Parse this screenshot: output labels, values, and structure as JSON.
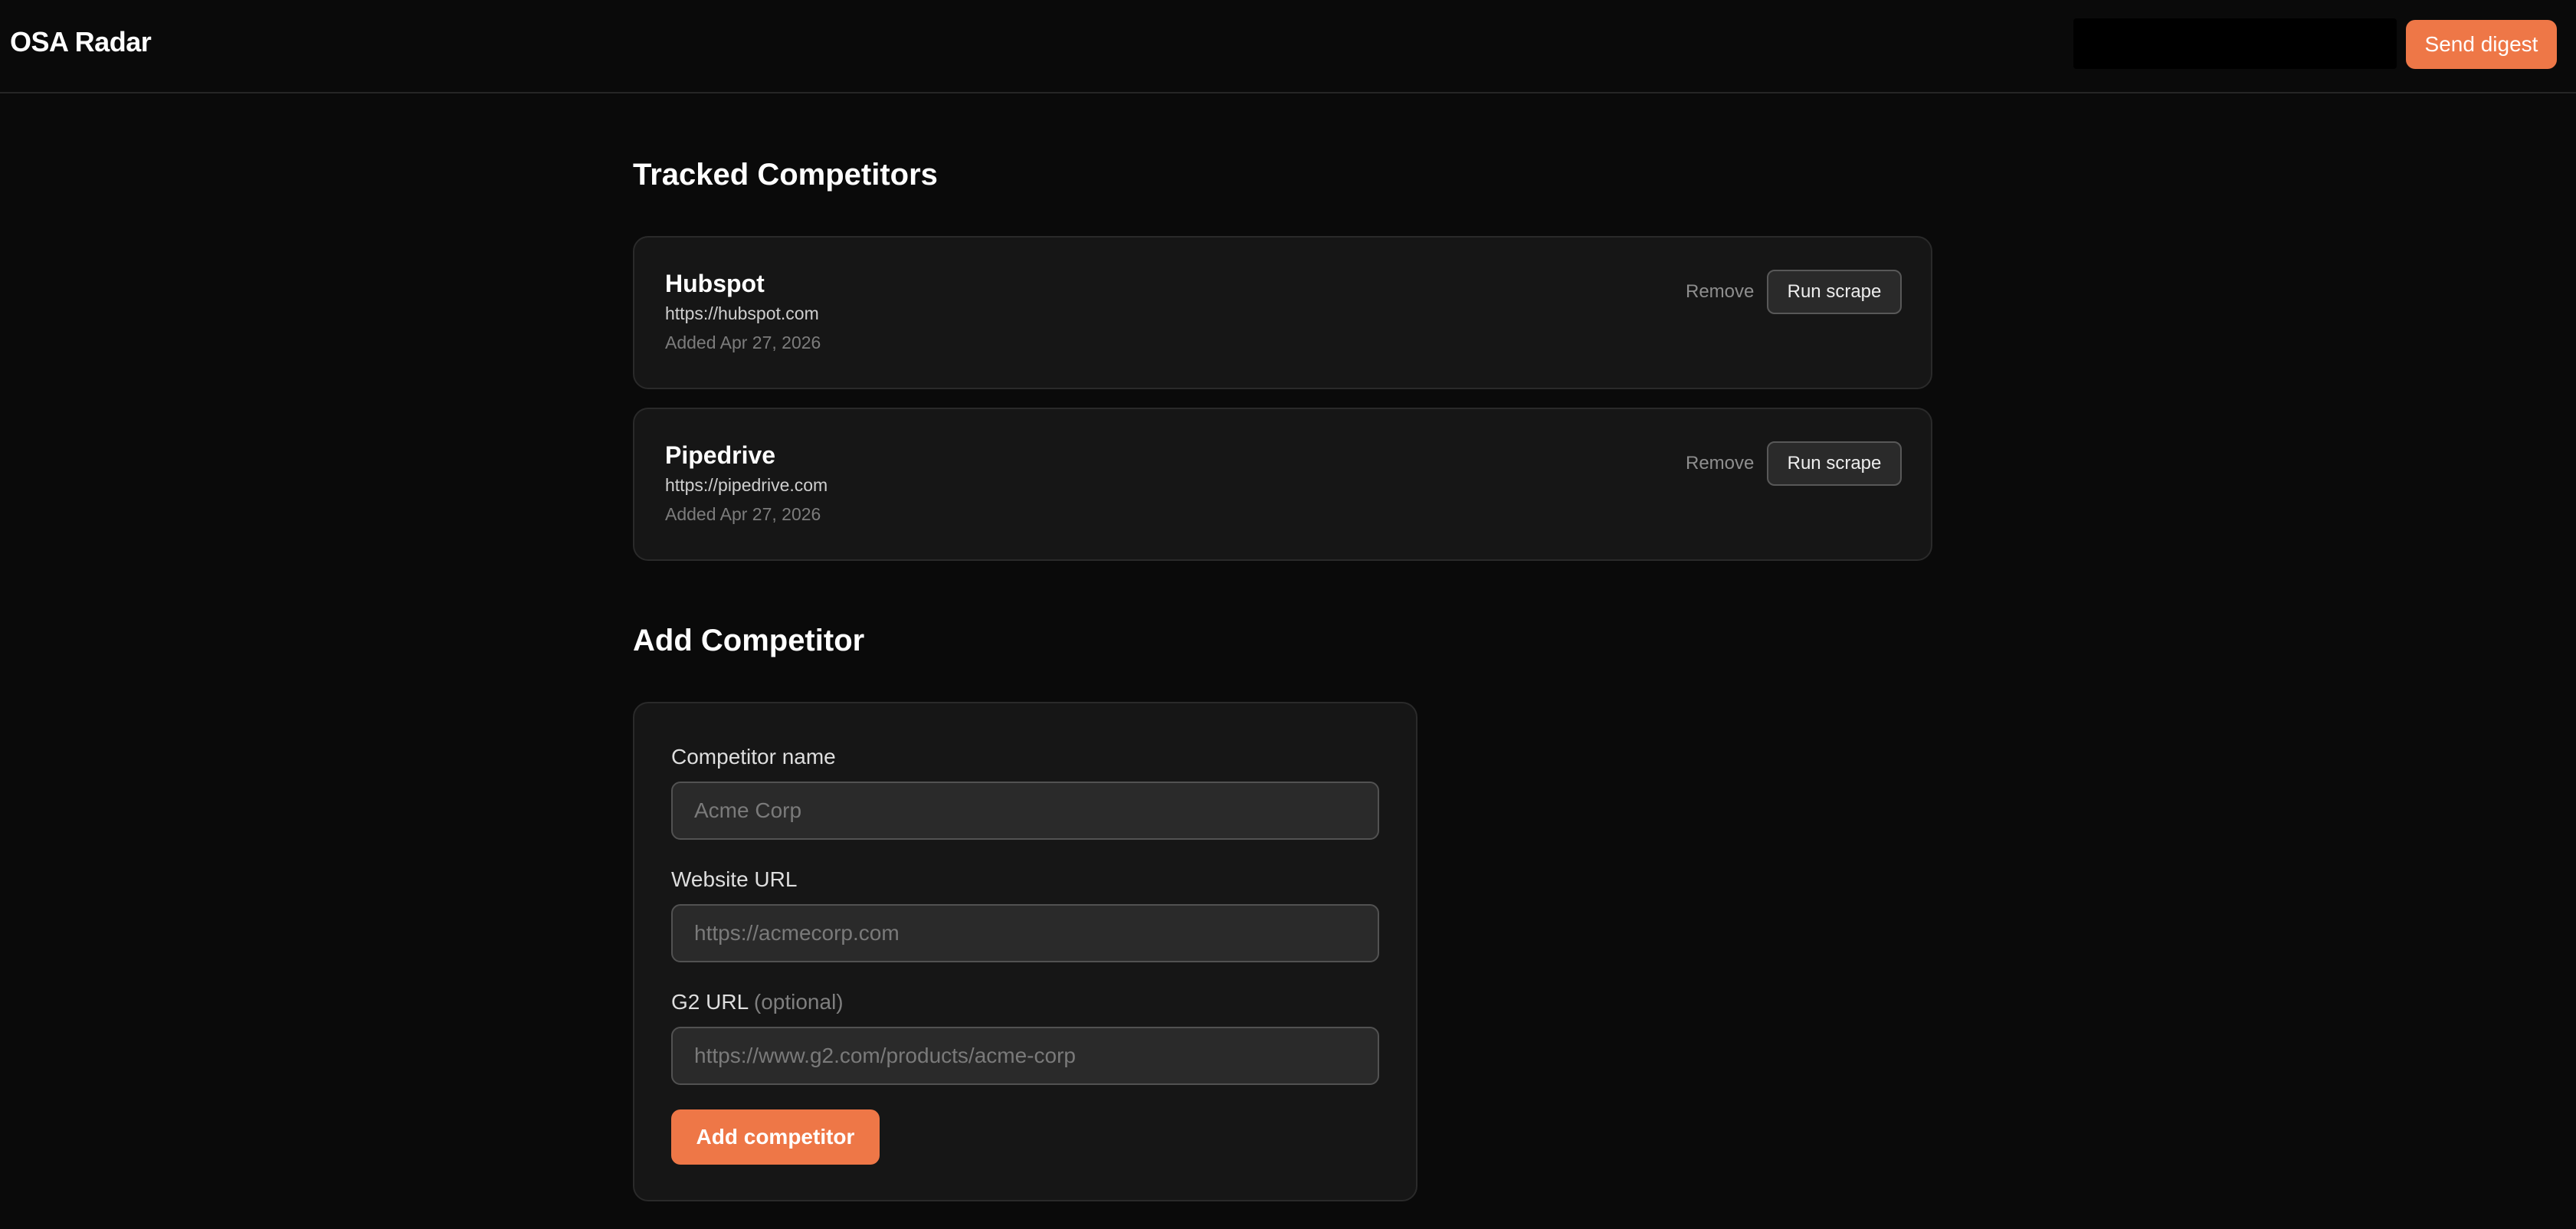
{
  "header": {
    "app_title": "OSA Radar",
    "send_digest_label": "Send digest"
  },
  "tracked": {
    "title": "Tracked Competitors",
    "competitors": [
      {
        "name": "Hubspot",
        "url": "https://hubspot.com",
        "added": "Added Apr 27, 2026",
        "remove_label": "Remove",
        "run_label": "Run scrape"
      },
      {
        "name": "Pipedrive",
        "url": "https://pipedrive.com",
        "added": "Added Apr 27, 2026",
        "remove_label": "Remove",
        "run_label": "Run scrape"
      }
    ]
  },
  "add_form": {
    "title": "Add Competitor",
    "name_label": "Competitor name",
    "name_placeholder": "Acme Corp",
    "website_label": "Website URL",
    "website_placeholder": "https://acmecorp.com",
    "g2_label": "G2 URL",
    "g2_optional": "(optional)",
    "g2_placeholder": "https://www.g2.com/products/acme-corp",
    "submit_label": "Add competitor"
  },
  "colors": {
    "accent": "#ee7747",
    "background": "#0a0a0a",
    "card": "#161616"
  }
}
